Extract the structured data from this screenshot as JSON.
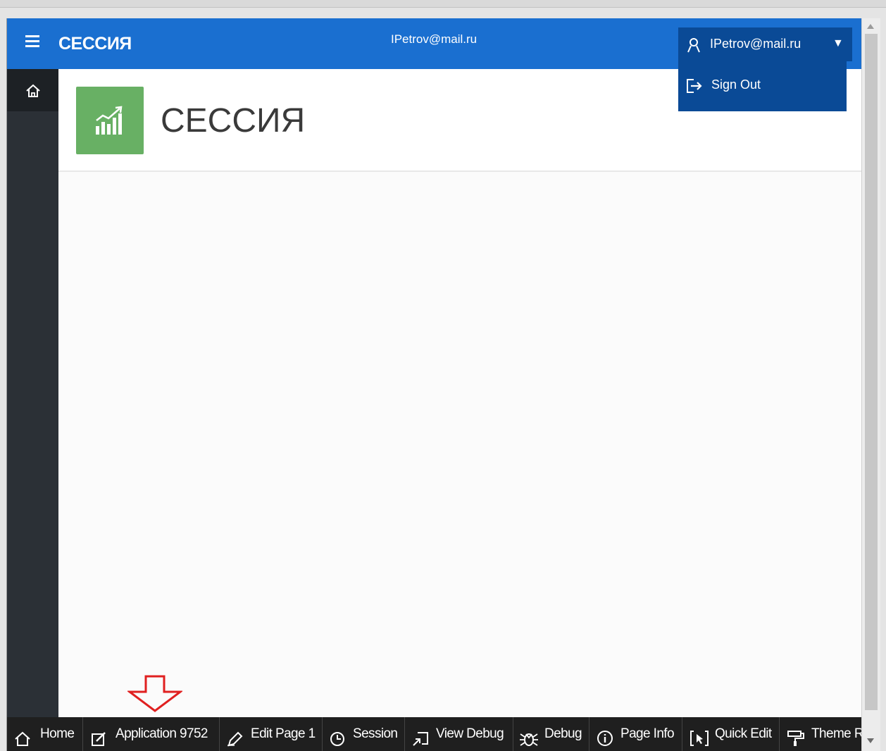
{
  "header": {
    "app_title": "СЕССИЯ",
    "user_center": "IPetrov@mail.ru",
    "user_menu_label": "IPetrov@mail.ru",
    "caret": "▼",
    "menu_items": [
      {
        "label": "Sign Out",
        "icon": "sign-out-icon"
      }
    ]
  },
  "sidebar": {
    "items": [
      {
        "icon": "home-icon"
      }
    ]
  },
  "page": {
    "title": "СЕССИЯ",
    "icon": "chart-growth-icon",
    "icon_color": "#68b064"
  },
  "devbar": {
    "items": [
      {
        "label": "Home",
        "icon": "home-icon"
      },
      {
        "label": "Application 9752",
        "icon": "edit-app-icon"
      },
      {
        "label": "Edit Page 1",
        "icon": "pencil-icon"
      },
      {
        "label": "Session",
        "icon": "clock-icon"
      },
      {
        "label": "View Debug",
        "icon": "view-debug-icon"
      },
      {
        "label": "Debug",
        "icon": "bug-icon"
      },
      {
        "label": "Page Info",
        "icon": "info-icon"
      },
      {
        "label": "Quick Edit",
        "icon": "quick-edit-icon"
      },
      {
        "label": "Theme R",
        "icon": "paint-roller-icon"
      }
    ]
  },
  "colors": {
    "header": "#1a6fd0",
    "user_menu": "#0a4a96",
    "sidebar": "#2b3036",
    "devbar": "#1f1f1f",
    "annotation": "#e02020"
  }
}
